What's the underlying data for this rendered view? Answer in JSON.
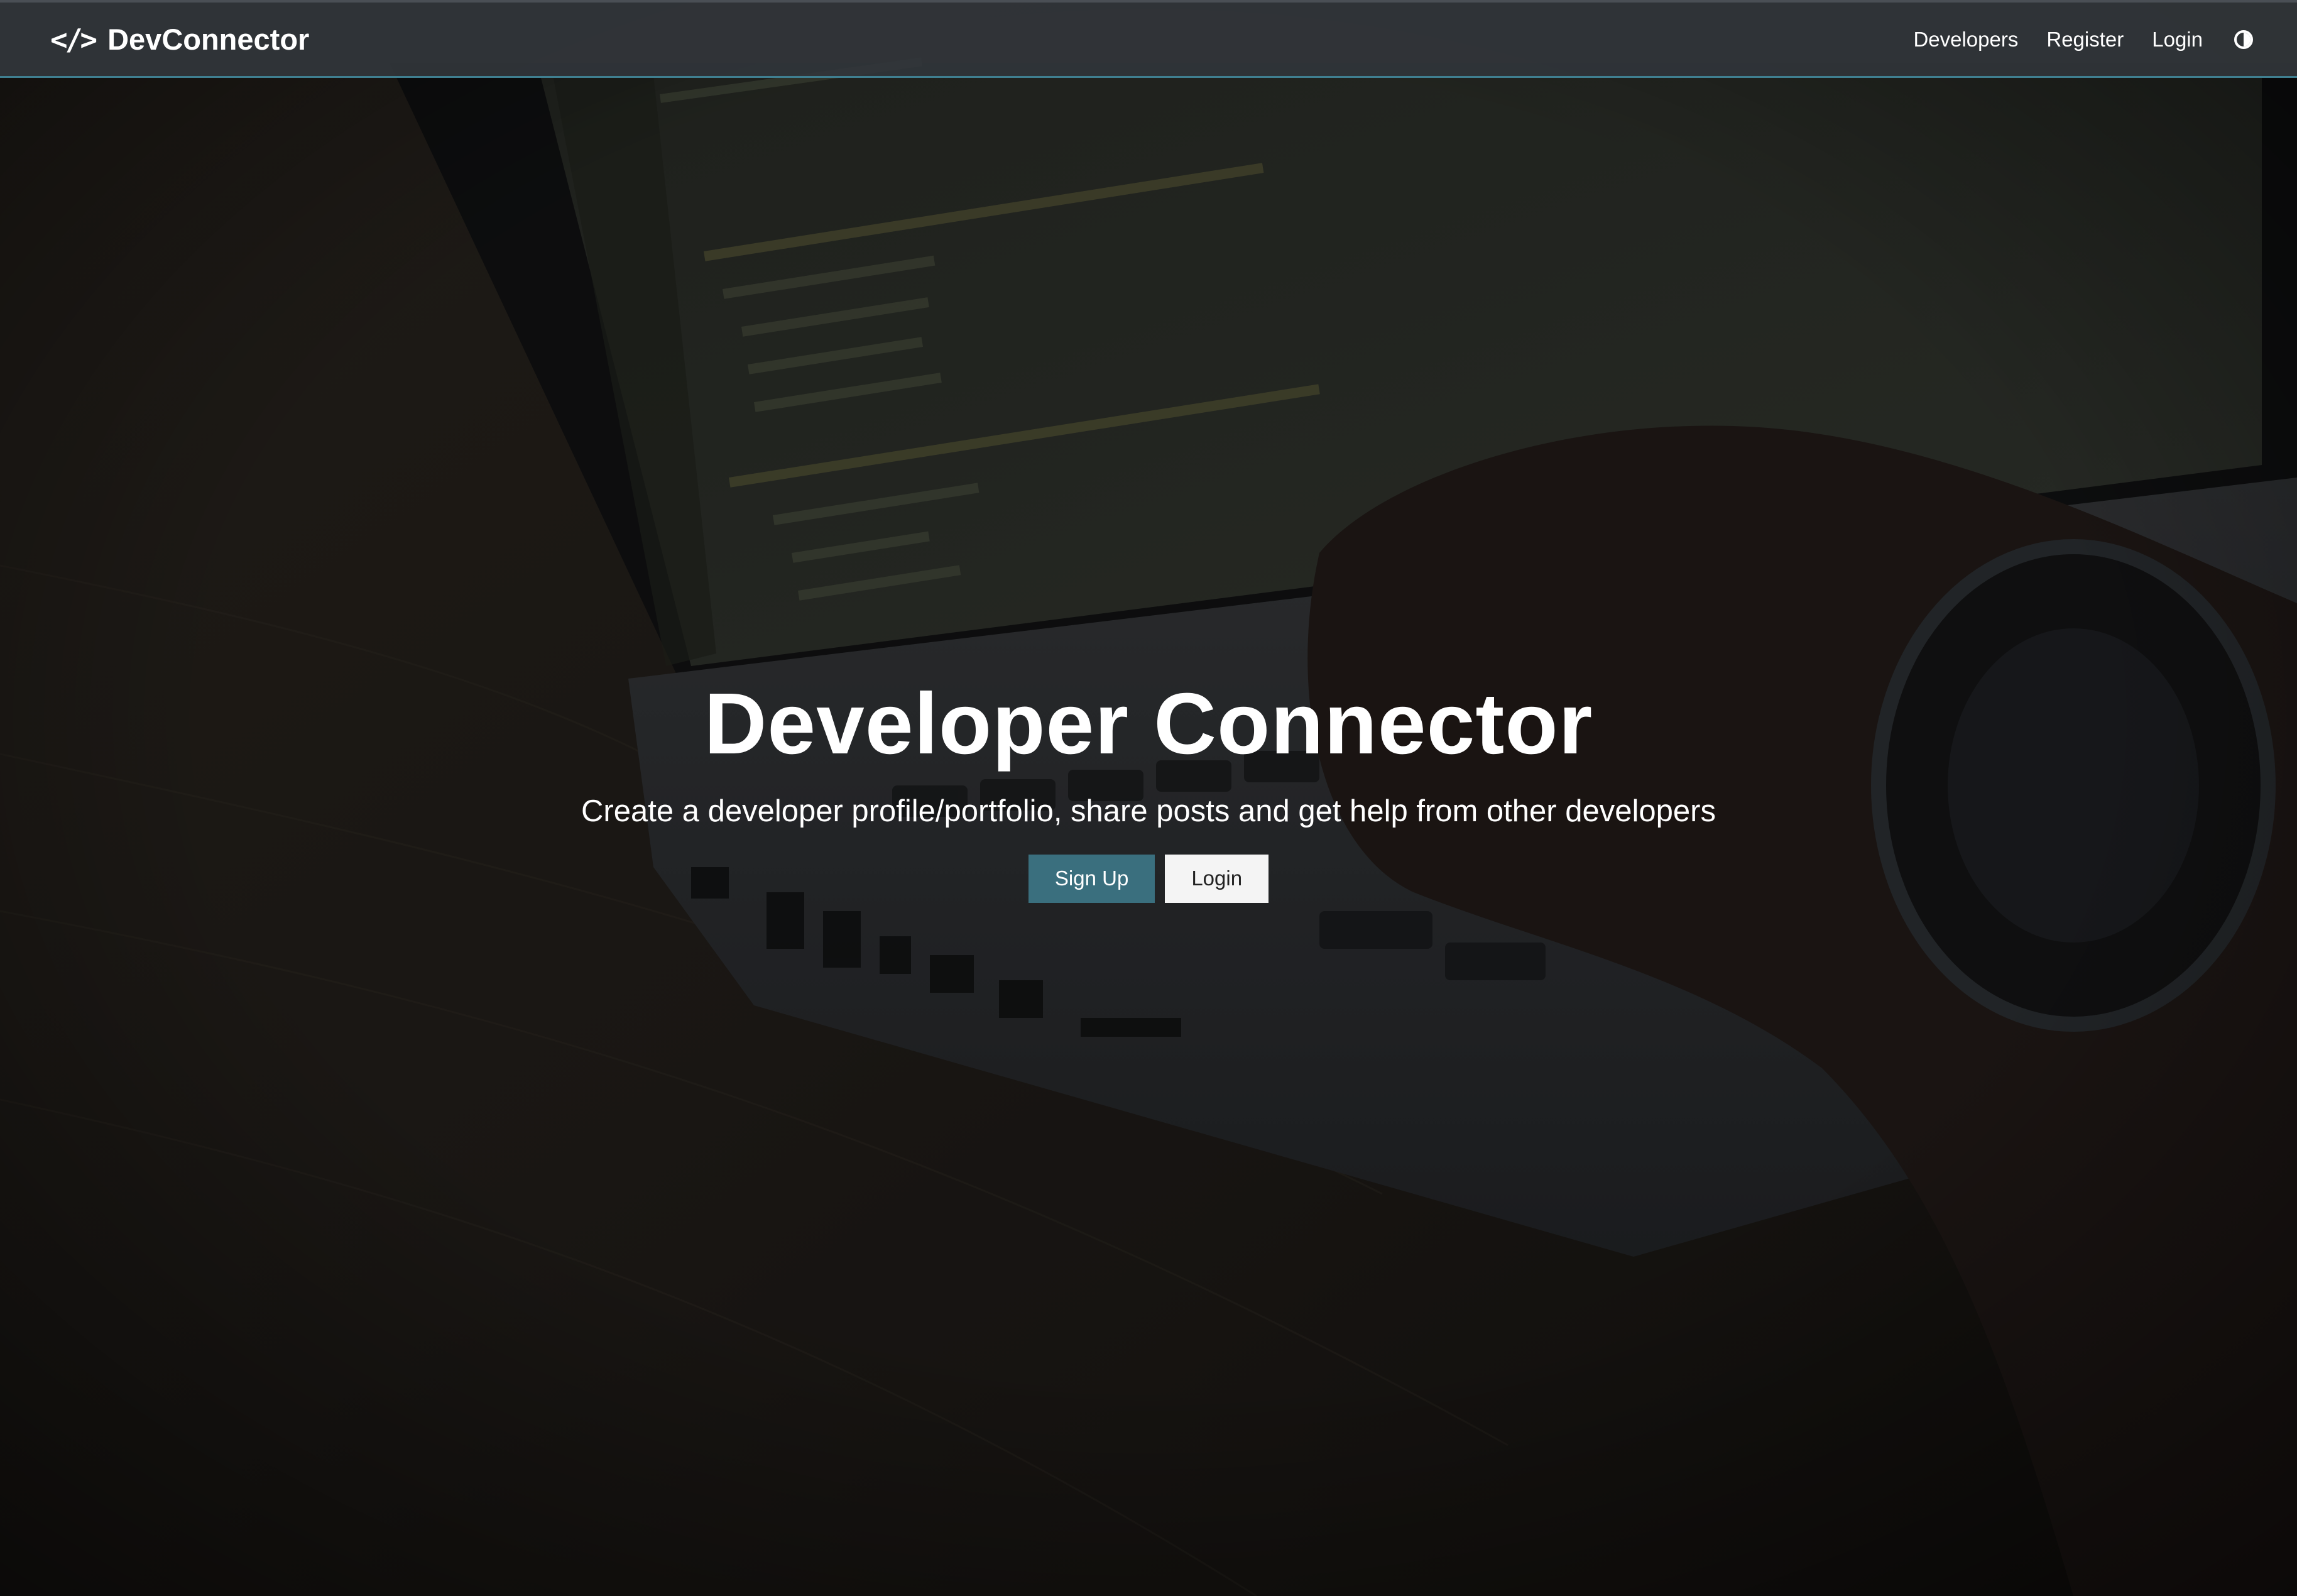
{
  "nav": {
    "brand_icon": "</>",
    "brand_name": "DevConnector",
    "links": {
      "developers": "Developers",
      "register": "Register",
      "login": "Login"
    },
    "theme_toggle_icon": "half-circle-contrast-icon"
  },
  "hero": {
    "title": "Developer Connector",
    "subtitle": "Create a developer profile/portfolio, share posts and get help from other developers",
    "buttons": {
      "signup": "Sign Up",
      "login": "Login"
    }
  },
  "colors": {
    "primary": "#3a6f7e",
    "navbar_bg": "#32363a",
    "navbar_border": "#3f7f90",
    "light_button": "#f4f4f4"
  }
}
